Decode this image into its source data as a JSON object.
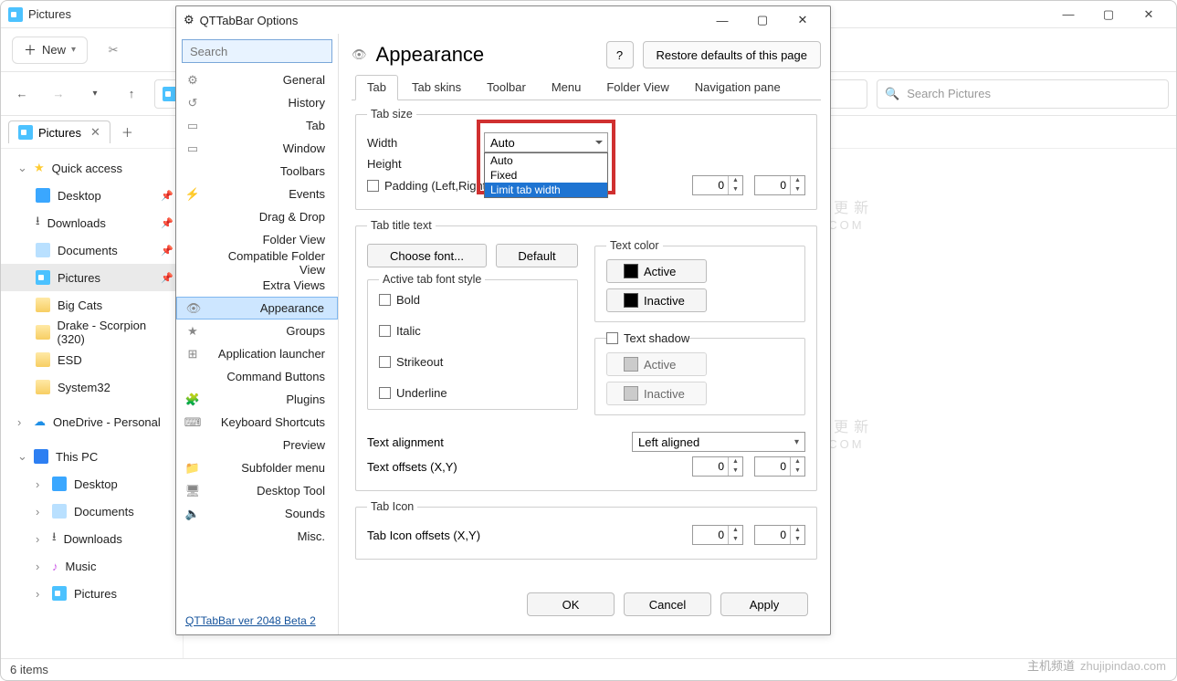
{
  "explorer": {
    "title": "Pictures",
    "new_button": "New",
    "nav_back": "←",
    "nav_fwd": "→",
    "nav_up": "↑",
    "search_placeholder": "Search Pictures",
    "tab_label": "Pictures",
    "status": "6 items",
    "sidebar": {
      "quick_access": "Quick access",
      "desktop": "Desktop",
      "downloads": "Downloads",
      "documents": "Documents",
      "pictures": "Pictures",
      "big_cats": "Big Cats",
      "drake": "Drake - Scorpion (320)",
      "esd": "ESD",
      "system32": "System32",
      "onedrive": "OneDrive - Personal",
      "this_pc": "This PC",
      "pc_desktop": "Desktop",
      "pc_documents": "Documents",
      "pc_downloads": "Downloads",
      "pc_music": "Music",
      "pc_pictures": "Pictures"
    }
  },
  "dialog": {
    "title": "QTTabBar Options",
    "search_placeholder": "Search",
    "header": "Appearance",
    "help": "?",
    "restore": "Restore defaults of this page",
    "version": "QTTabBar ver 2048 Beta 2",
    "categories": [
      "General",
      "History",
      "Tab",
      "Window",
      "Toolbars",
      "Events",
      "Drag & Drop",
      "Folder View",
      "Compatible Folder View",
      "Extra Views",
      "Appearance",
      "Groups",
      "Application launcher",
      "Command Buttons",
      "Plugins",
      "Keyboard Shortcuts",
      "Preview",
      "Subfolder menu",
      "Desktop Tool",
      "Sounds",
      "Misc."
    ],
    "selected_category_index": 10,
    "subtabs": [
      "Tab",
      "Tab skins",
      "Toolbar",
      "Menu",
      "Folder View",
      "Navigation pane"
    ],
    "active_subtab_index": 0,
    "tabsize": {
      "legend": "Tab size",
      "width_label": "Width",
      "height_label": "Height",
      "width_value": "Auto",
      "width_options": [
        "Auto",
        "Fixed",
        "Limit tab width"
      ],
      "highlighted_option_index": 2,
      "padding_label": "Padding (Left,Right)",
      "pad_left": "0",
      "pad_right": "0"
    },
    "title_text": {
      "legend": "Tab title text",
      "choose_font": "Choose font...",
      "default": "Default",
      "active_font_legend": "Active tab font style",
      "bold": "Bold",
      "italic": "Italic",
      "strikeout": "Strikeout",
      "underline": "Underline",
      "text_color_legend": "Text color",
      "active": "Active",
      "inactive": "Inactive",
      "text_shadow": "Text shadow",
      "shadow_active": "Active",
      "shadow_inactive": "Inactive",
      "alignment_label": "Text alignment",
      "alignment_value": "Left aligned",
      "offsets_label": "Text offsets (X,Y)",
      "off_x": "0",
      "off_y": "0"
    },
    "tab_icon": {
      "legend": "Tab Icon",
      "offsets_label": "Tab Icon offsets (X,Y)",
      "off_x": "0",
      "off_y": "0"
    },
    "footer": {
      "ok": "OK",
      "cancel": "Cancel",
      "apply": "Apply"
    }
  },
  "watermark": {
    "cn": "主机频道",
    "sub": "每日更新",
    "domain": "ZHUJIPINDAO.COM",
    "site": "zhujipindao.com"
  }
}
